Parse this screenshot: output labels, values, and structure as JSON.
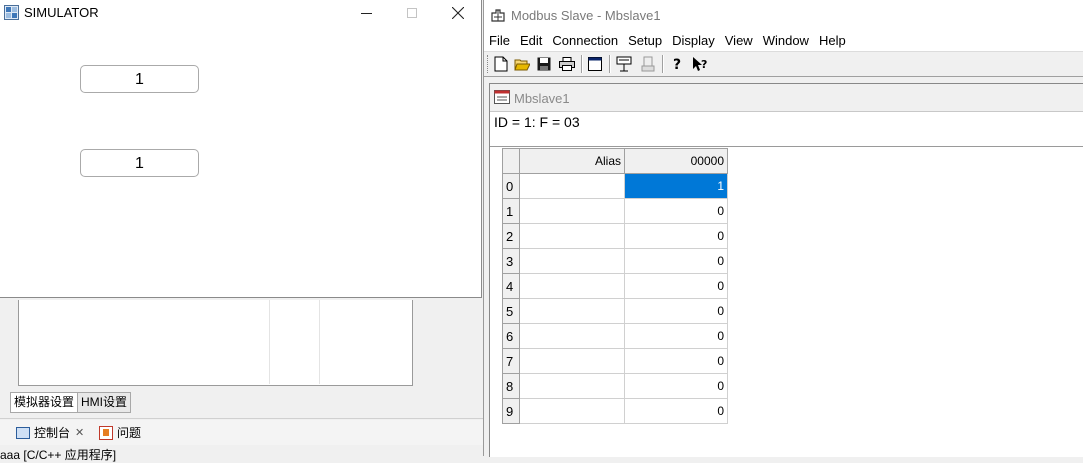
{
  "simulator": {
    "title": "SIMULATOR",
    "field1_value": "1",
    "field2_value": "1"
  },
  "ide": {
    "tabs": [
      "模拟器设置",
      "HMI设置"
    ],
    "console_tab": "控制台",
    "problems_tab": "问题",
    "console_line": "aaa [C/C++ 应用程序]"
  },
  "modbus": {
    "title": "Modbus Slave - Mbslave1",
    "menu": [
      "File",
      "Edit",
      "Connection",
      "Setup",
      "Display",
      "View",
      "Window",
      "Help"
    ],
    "child_title": "Mbslave1",
    "info": "ID = 1: F = 03",
    "grid": {
      "alias_header": "Alias",
      "address_header": "00000",
      "row_numbers": [
        "0",
        "1",
        "2",
        "3",
        "4",
        "5",
        "6",
        "7",
        "8",
        "9"
      ],
      "values": [
        "1",
        "0",
        "0",
        "0",
        "0",
        "0",
        "0",
        "0",
        "0",
        "0"
      ],
      "selected_row": 0
    }
  },
  "colors": {
    "selection": "#0078d7"
  }
}
